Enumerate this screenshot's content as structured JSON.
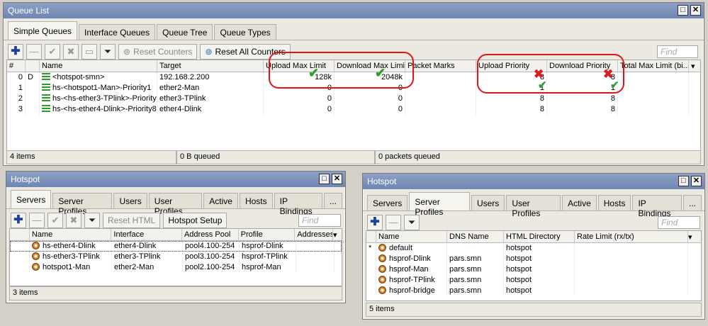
{
  "queue_list": {
    "title": "Queue List",
    "tabs": [
      "Simple Queues",
      "Interface Queues",
      "Queue Tree",
      "Queue Types"
    ],
    "toolbar": {
      "reset_counters": "Reset Counters",
      "reset_all_counters": "Reset All Counters",
      "find_placeholder": "Find"
    },
    "columns": [
      "#",
      "",
      "Name",
      "Target",
      "Upload Max Limit",
      "Download Max Limit",
      "Packet Marks",
      "Upload Priority",
      "Download Priority",
      "Total Max Limit (bi..."
    ],
    "rows": [
      {
        "num": "0",
        "flag": "D",
        "name": "<hotspot-smn>",
        "target": "192.168.2.200",
        "up_max": "128k",
        "down_max": "2048k",
        "marks": "",
        "up_prio": "8",
        "down_prio": "8"
      },
      {
        "num": "1",
        "flag": "",
        "name": "hs-<hotspot1-Man>-Priority1",
        "target": "ether2-Man",
        "up_max": "0",
        "down_max": "0",
        "marks": "",
        "up_prio": "1",
        "down_prio": "1"
      },
      {
        "num": "2",
        "flag": "",
        "name": "hs-<hs-ether3-TPlink>-Priority8",
        "target": "ether3-TPlink",
        "up_max": "0",
        "down_max": "0",
        "marks": "",
        "up_prio": "8",
        "down_prio": "8"
      },
      {
        "num": "3",
        "flag": "",
        "name": "hs-<hs-ether4-Dlink>-Priority8",
        "target": "ether4-Dlink",
        "up_max": "0",
        "down_max": "0",
        "marks": "",
        "up_prio": "8",
        "down_prio": "8"
      }
    ],
    "status": {
      "items": "4 items",
      "queued": "0 B queued",
      "packets": "0 packets queued"
    }
  },
  "hotspot_servers": {
    "title": "Hotspot",
    "tabs": [
      "Servers",
      "Server Profiles",
      "Users",
      "User Profiles",
      "Active",
      "Hosts",
      "IP Bindings",
      "..."
    ],
    "toolbar": {
      "reset_html": "Reset HTML",
      "hotspot_setup": "Hotspot Setup",
      "find_placeholder": "Find"
    },
    "columns": [
      "Name",
      "Interface",
      "Address Pool",
      "Profile",
      "Addresses"
    ],
    "rows": [
      {
        "name": "hs-ether4-Dlink",
        "interface": "ether4-Dlink",
        "pool": "pool4.100-254",
        "profile": "hsprof-Dlink"
      },
      {
        "name": "hs-ether3-TPlink",
        "interface": "ether3-TPlink",
        "pool": "pool3.100-254",
        "profile": "hsprof-TPlink"
      },
      {
        "name": "hotspot1-Man",
        "interface": "ether2-Man",
        "pool": "pool2.100-254",
        "profile": "hsprof-Man"
      }
    ],
    "status": "3 items"
  },
  "hotspot_profiles": {
    "title": "Hotspot",
    "tabs": [
      "Servers",
      "Server Profiles",
      "Users",
      "User Profiles",
      "Active",
      "Hosts",
      "IP Bindings",
      "..."
    ],
    "toolbar": {
      "find_placeholder": "Find"
    },
    "columns": [
      "Name",
      "DNS Name",
      "HTML Directory",
      "Rate Limit (rx/tx)"
    ],
    "rows": [
      {
        "flag": "*",
        "name": "default",
        "dns": "",
        "dir": "hotspot",
        "rate": ""
      },
      {
        "flag": "",
        "name": "hsprof-Dlink",
        "dns": "pars.smn",
        "dir": "hotspot",
        "rate": ""
      },
      {
        "flag": "",
        "name": "hsprof-Man",
        "dns": "pars.smn",
        "dir": "hotspot",
        "rate": ""
      },
      {
        "flag": "",
        "name": "hsprof-TPlink",
        "dns": "pars.smn",
        "dir": "hotspot",
        "rate": ""
      },
      {
        "flag": "",
        "name": "hsprof-bridge",
        "dns": "pars.smn",
        "dir": "hotspot",
        "rate": ""
      }
    ],
    "status": "5 items"
  },
  "colors": {
    "titlebar": "#7d92bd",
    "annotation_red": "#e0141a",
    "annotation_green": "#2aa12a"
  }
}
